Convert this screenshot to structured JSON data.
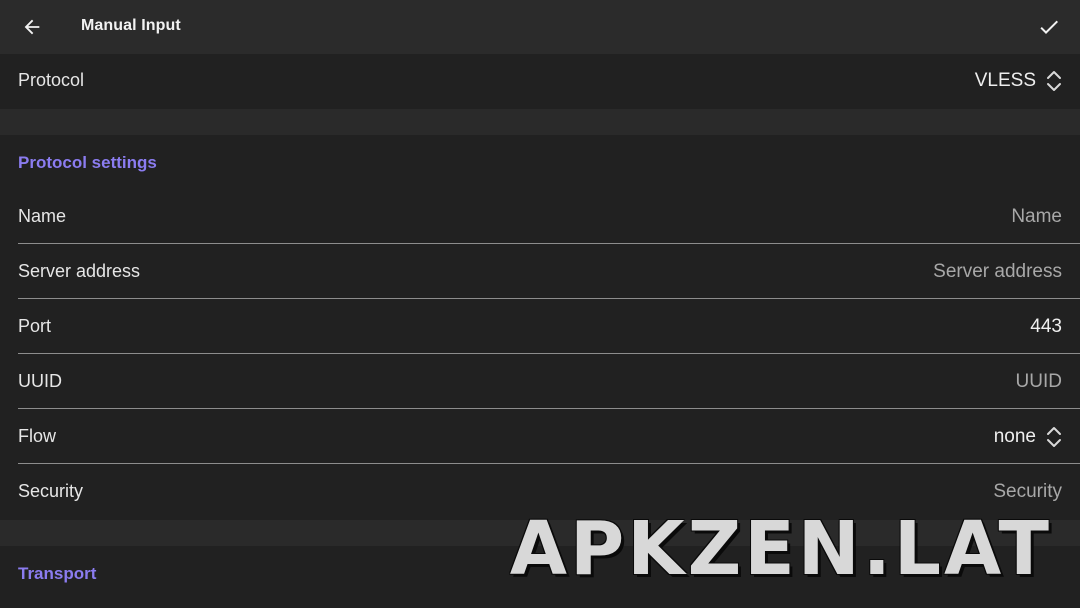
{
  "app_bar": {
    "title": "Manual Input",
    "back_icon": "arrow-back-icon",
    "confirm_icon": "check-icon"
  },
  "protocol_row": {
    "label": "Protocol",
    "value": "VLESS"
  },
  "protocol_settings": {
    "header": "Protocol settings",
    "fields": {
      "name": {
        "label": "Name",
        "placeholder": "Name"
      },
      "server_address": {
        "label": "Server address",
        "placeholder": "Server address"
      },
      "port": {
        "label": "Port",
        "value": "443"
      },
      "uuid": {
        "label": "UUID",
        "placeholder": "UUID"
      },
      "flow": {
        "label": "Flow",
        "value": "none"
      },
      "security": {
        "label": "Security",
        "placeholder": "Security"
      }
    }
  },
  "transport": {
    "header": "Transport"
  },
  "watermark": "APKZEN.LAT",
  "colors": {
    "background": "#212121",
    "app_bar": "#2b2b2b",
    "section_gap": "#2a2a2a",
    "accent": "#8b7cf0",
    "divider": "#8d8d8d"
  }
}
